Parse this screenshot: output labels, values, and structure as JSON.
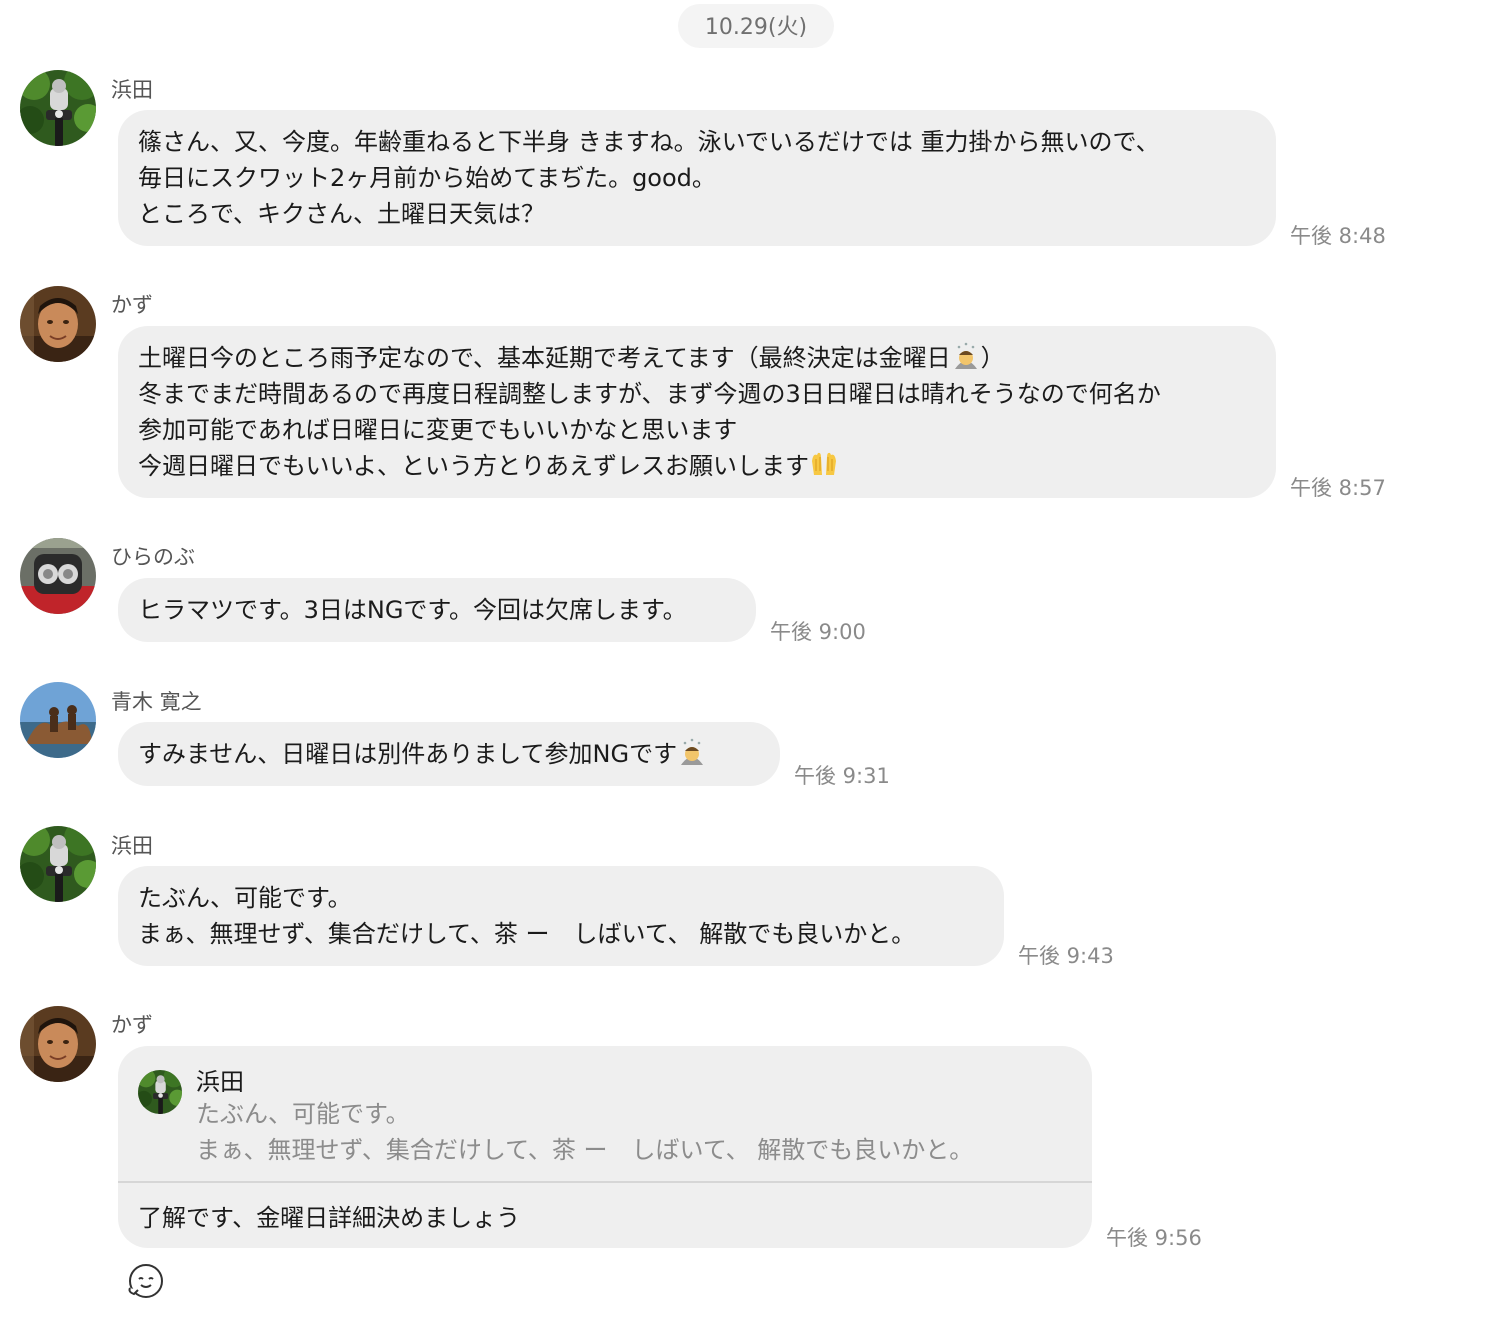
{
  "date_label": "10.29(火)",
  "messages": [
    {
      "sender": "浜田",
      "avatar_icon": "motorcycle-photo-avatar",
      "lines": [
        "篠さん、又、今度。年齢重ねると下半身 きますね。泳いでいるだけでは 重力掛から無いので、",
        "毎日にスクワット2ヶ月前から始めてまぢた。good。",
        "ところで、キクさん、土曜日天気は？"
      ],
      "time": "午後 8:48"
    },
    {
      "sender": "かず",
      "avatar_icon": "man-portrait-avatar",
      "lines": [
        "土曜日今のところ雨予定なので、基本延期で考えてます（最終決定は金曜日",
        "冬までまだ時間あるので再度日程調整しますが、まず今週の3日日曜日は晴れそうなので何名か",
        "参加可能であれば日曜日に変更でもいいかなと思います",
        "今週日曜日でもいいよ、という方とりあえずレスお願いします"
      ],
      "line1_suffix": "）",
      "inline_icons": [
        "bowing-person-emoji",
        "raising-hands-emoji"
      ],
      "time": "午後 8:57"
    },
    {
      "sender": "ひらのぶ",
      "avatar_icon": "motorcycle-headlights-avatar",
      "lines": [
        "ヒラマツです。3日はNGです。今回は欠席します。"
      ],
      "time": "午後 9:00"
    },
    {
      "sender": "青木 寛之",
      "avatar_icon": "people-sculpture-avatar",
      "lines": [
        "すみません、日曜日は別件ありまして参加NGです"
      ],
      "inline_icons": [
        "bowing-person-emoji"
      ],
      "time": "午後 9:31"
    },
    {
      "sender": "浜田",
      "avatar_icon": "motorcycle-photo-avatar",
      "lines": [
        "たぶん、可能です。",
        "まぁ、無理せず、集合だけして、茶 ー　しばいて、 解散でも良いかと。"
      ],
      "time": "午後 9:43"
    },
    {
      "sender": "かず",
      "avatar_icon": "man-portrait-avatar",
      "reply_to": {
        "sender": "浜田",
        "lines": [
          "たぶん、可能です。",
          "まぁ、無理せず、集合だけして、茶 ー　しばいて、 解散でも良いかと。"
        ]
      },
      "lines": [
        "了解です、金曜日詳細決めましょう"
      ],
      "time": "午後 9:56",
      "reaction_icon": "smiling-face-reaction-icon"
    }
  ]
}
